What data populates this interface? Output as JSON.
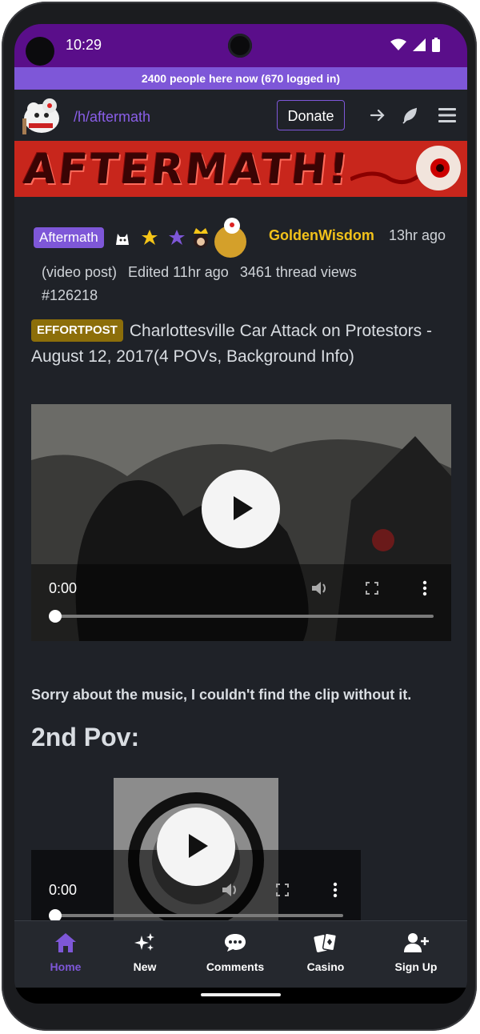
{
  "status_bar": {
    "time": "10:29"
  },
  "online": {
    "text": "2400 people here now (670 logged in)"
  },
  "nav": {
    "sub": "/h/aftermath",
    "donate": "Donate"
  },
  "banner": {
    "text": "AFTERMATH!"
  },
  "post": {
    "flair": "Aftermath",
    "author": "GoldenWisdom",
    "time_ago": "13hr ago",
    "type": "(video post)",
    "edited": "Edited 11hr ago",
    "views": "3461 thread views",
    "id": "#126218",
    "tag": "EFFORTPOST",
    "title": "Charlottesville Car Attack on Protestors - August 12, 2017(4 POVs, Background Info)",
    "video1_time": "0:00",
    "body_text": "Sorry about the music, I couldn't find the clip without it.",
    "heading2": "2nd Pov:",
    "video2_time": "0:00"
  },
  "bottom_nav": {
    "items": [
      {
        "label": "Home",
        "icon": "home-icon"
      },
      {
        "label": "New",
        "icon": "sparkles-icon"
      },
      {
        "label": "Comments",
        "icon": "comment-icon"
      },
      {
        "label": "Casino",
        "icon": "cards-icon"
      },
      {
        "label": "Sign Up",
        "icon": "user-plus-icon"
      }
    ]
  },
  "colors": {
    "status_bar": "#5a0e8a",
    "accent": "#7e57d8",
    "author": "#f2c21a",
    "background": "#1f2228"
  }
}
